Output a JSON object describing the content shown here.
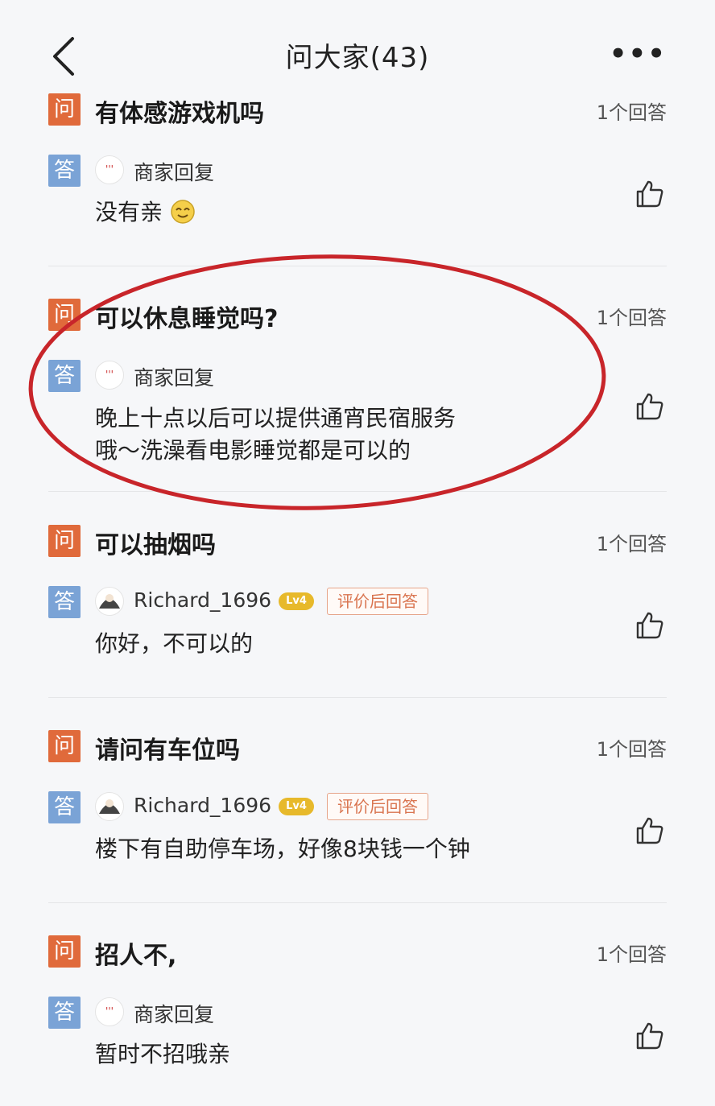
{
  "header": {
    "title": "问大家(43)",
    "more": "•••"
  },
  "labels": {
    "question_badge": "问",
    "answer_badge": "答",
    "level_badge": "Lv4"
  },
  "colors": {
    "question_badge": "#e06a3b",
    "answer_badge": "#7aa3d6",
    "circle": "#c8252a",
    "tag": "#d9744f",
    "level": "#e7b92b"
  },
  "qa": [
    {
      "question": "有体感游戏机吗",
      "count": "1个回答",
      "answerer": "商家回复",
      "answerer_type": "merchant",
      "answer": "没有亲",
      "emoji": "smile"
    },
    {
      "question": "可以休息睡觉吗?",
      "count": "1个回答",
      "answerer": "商家回复",
      "answerer_type": "merchant",
      "answer_lines": [
        "晚上十点以后可以提供通宵民宿服务",
        "哦～洗澡看电影睡觉都是可以的"
      ]
    },
    {
      "question": "可以抽烟吗",
      "count": "1个回答",
      "answerer": "Richard_1696",
      "answerer_type": "user",
      "tag": "评价后回答",
      "answer": "你好，不可以的"
    },
    {
      "question": "请问有车位吗",
      "count": "1个回答",
      "answerer": "Richard_1696",
      "answerer_type": "user",
      "tag": "评价后回答",
      "answer": "楼下有自助停车场，好像8块钱一个钟"
    },
    {
      "question": "招人不,",
      "count": "1个回答",
      "answerer": "商家回复",
      "answerer_type": "merchant",
      "answer": "暂时不招哦亲"
    }
  ]
}
